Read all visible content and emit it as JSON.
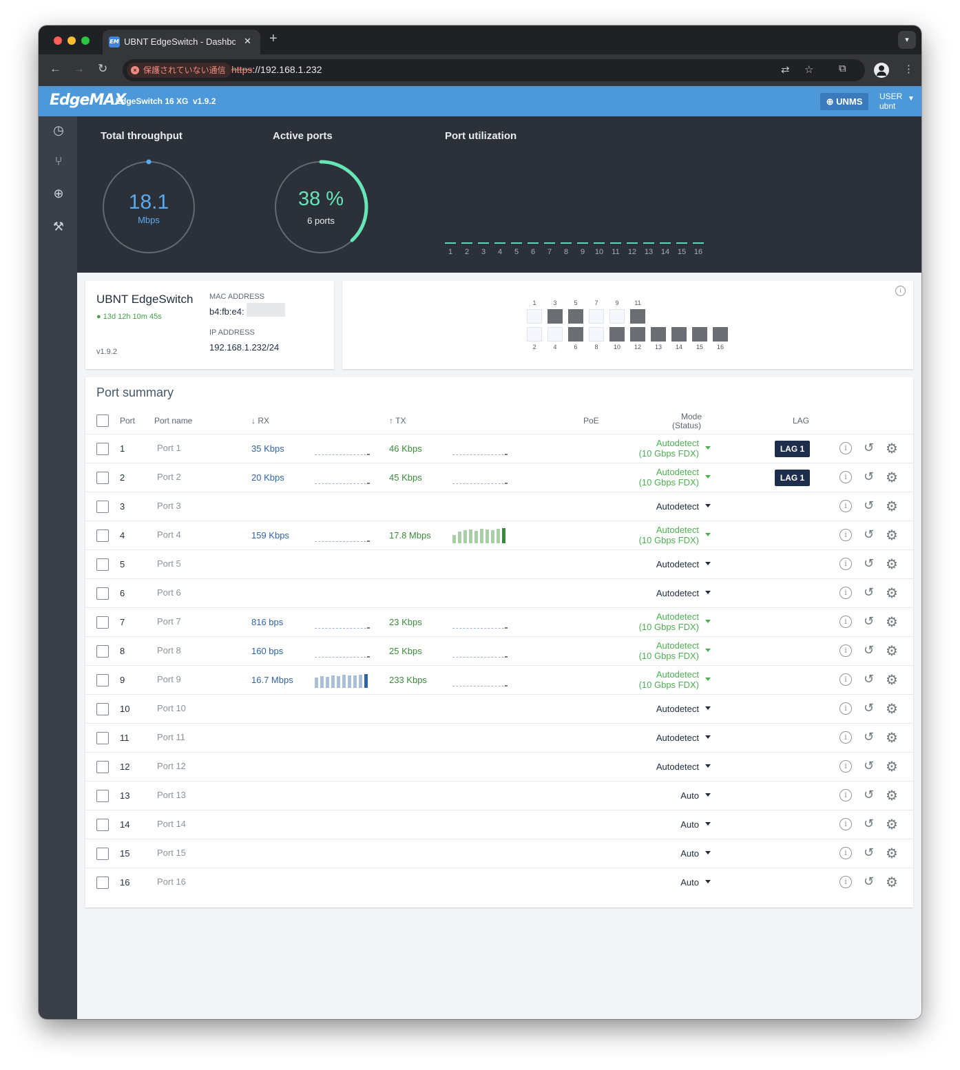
{
  "browser": {
    "tab_title": "UBNT EdgeSwitch - Dashboard",
    "favicon": "EM",
    "tab_close": "✕",
    "new_tab": "+",
    "security_label": "保護されていない通信",
    "url_scheme": "https",
    "url_rest": "://192.168.1.232"
  },
  "header": {
    "logo": "EdgeMAX",
    "model": "EdgeSwitch 16 XG",
    "version": "v1.9.2",
    "unms_label": "UNMS",
    "user_label": "USER",
    "user_name": "ubnt"
  },
  "dashboard": {
    "throughput_title": "Total throughput",
    "throughput_value": "18.1",
    "throughput_unit": "Mbps",
    "active_ports_title": "Active ports",
    "active_ports_value": "38 %",
    "active_ports_fraction": 0.38,
    "active_ports_count": "6 ports",
    "port_util_title": "Port utilization",
    "port_util_labels": [
      "1",
      "2",
      "3",
      "4",
      "5",
      "6",
      "7",
      "8",
      "9",
      "10",
      "11",
      "12",
      "13",
      "14",
      "15",
      "16"
    ],
    "colors": {
      "throughput": "#5aaaf0",
      "active": "#66e5b7"
    }
  },
  "device": {
    "name": "UBNT EdgeSwitch",
    "uptime": "13d 12h 10m 45s",
    "version": "v1.9.2",
    "mac_label": "MAC ADDRESS",
    "mac_value": "b4:fb:e4:",
    "ip_label": "IP ADDRESS",
    "ip_value": "192.168.1.232/24"
  },
  "switch_panel": {
    "top_labels": [
      "1",
      "3",
      "5",
      "7",
      "9",
      "11"
    ],
    "bottom_labels": [
      "2",
      "4",
      "6",
      "8",
      "10",
      "12",
      "13",
      "14",
      "15",
      "16"
    ],
    "top_states": [
      "idle",
      "active",
      "active",
      "idle",
      "idle",
      "active"
    ],
    "bottom_states": [
      "idle",
      "idle",
      "active",
      "idle",
      "active",
      "active",
      "active",
      "active",
      "active",
      "active"
    ]
  },
  "summary": {
    "title": "Port summary",
    "col_port": "Port",
    "col_name": "Port name",
    "col_rx": "↓ RX",
    "col_tx": "↑ TX",
    "col_poe": "PoE",
    "col_mode": "Mode",
    "col_status": "(Status)",
    "col_lag": "LAG",
    "rows": [
      {
        "port": "1",
        "name": "Port 1",
        "rx": "35 Kbps",
        "tx": "46 Kbps",
        "mode": "Autodetect",
        "status": "(10 Gbps FDX)",
        "lag": "LAG 1"
      },
      {
        "port": "2",
        "name": "Port 2",
        "rx": "20 Kbps",
        "tx": "45 Kbps",
        "mode": "Autodetect",
        "status": "(10 Gbps FDX)",
        "lag": "LAG 1"
      },
      {
        "port": "3",
        "name": "Port 3",
        "rx": "",
        "tx": "",
        "mode": "Autodetect",
        "status": "",
        "lag": ""
      },
      {
        "port": "4",
        "name": "Port 4",
        "rx": "159 Kbps",
        "tx": "17.8 Mbps",
        "mode": "Autodetect",
        "status": "(10 Gbps FDX)",
        "lag": ""
      },
      {
        "port": "5",
        "name": "Port 5",
        "rx": "",
        "tx": "",
        "mode": "Autodetect",
        "status": "",
        "lag": ""
      },
      {
        "port": "6",
        "name": "Port 6",
        "rx": "",
        "tx": "",
        "mode": "Autodetect",
        "status": "",
        "lag": ""
      },
      {
        "port": "7",
        "name": "Port 7",
        "rx": "816 bps",
        "tx": "23 Kbps",
        "mode": "Autodetect",
        "status": "(10 Gbps FDX)",
        "lag": ""
      },
      {
        "port": "8",
        "name": "Port 8",
        "rx": "160 bps",
        "tx": "25 Kbps",
        "mode": "Autodetect",
        "status": "(10 Gbps FDX)",
        "lag": ""
      },
      {
        "port": "9",
        "name": "Port 9",
        "rx": "16.7 Mbps",
        "tx": "233 Kbps",
        "mode": "Autodetect",
        "status": "(10 Gbps FDX)",
        "lag": ""
      },
      {
        "port": "10",
        "name": "Port 10",
        "rx": "",
        "tx": "",
        "mode": "Autodetect",
        "status": "",
        "lag": ""
      },
      {
        "port": "11",
        "name": "Port 11",
        "rx": "",
        "tx": "",
        "mode": "Autodetect",
        "status": "",
        "lag": ""
      },
      {
        "port": "12",
        "name": "Port 12",
        "rx": "",
        "tx": "",
        "mode": "Autodetect",
        "status": "",
        "lag": ""
      },
      {
        "port": "13",
        "name": "Port 13",
        "rx": "",
        "tx": "",
        "mode": "Auto",
        "status": "",
        "lag": ""
      },
      {
        "port": "14",
        "name": "Port 14",
        "rx": "",
        "tx": "",
        "mode": "Auto",
        "status": "",
        "lag": ""
      },
      {
        "port": "15",
        "name": "Port 15",
        "rx": "",
        "tx": "",
        "mode": "Auto",
        "status": "",
        "lag": ""
      },
      {
        "port": "16",
        "name": "Port 16",
        "rx": "",
        "tx": "",
        "mode": "Auto",
        "status": "",
        "lag": ""
      }
    ],
    "colors": {
      "rx": "#2f63a6",
      "tx": "#3a8a3a",
      "mode_active": "#4caf50"
    }
  }
}
